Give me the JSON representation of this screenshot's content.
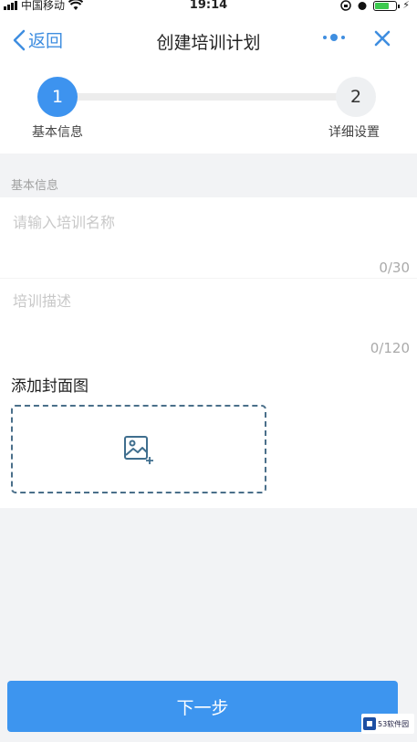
{
  "status_bar": {
    "carrier": "中国移动",
    "time": "19:14"
  },
  "nav": {
    "back_label": "返回",
    "title": "创建培训计划",
    "more_icon": "more-dots-icon",
    "close_icon": "close-icon"
  },
  "stepper": {
    "steps": [
      {
        "number": "1",
        "label": "基本信息",
        "active": true
      },
      {
        "number": "2",
        "label": "详细设置",
        "active": false
      }
    ]
  },
  "section": {
    "header": "基本信息"
  },
  "form": {
    "name": {
      "placeholder": "请输入培训名称",
      "value": "",
      "counter": "0/30"
    },
    "description": {
      "placeholder": "培训描述",
      "value": "",
      "counter": "0/120"
    },
    "cover": {
      "label": "添加封面图",
      "icon": "add-image-icon"
    }
  },
  "next_button": {
    "label": "下一步"
  },
  "watermark": {
    "text": "53软件园"
  },
  "colors": {
    "accent": "#3d93ef",
    "nav_blue": "#3f8ee0",
    "background": "#f2f3f5"
  }
}
